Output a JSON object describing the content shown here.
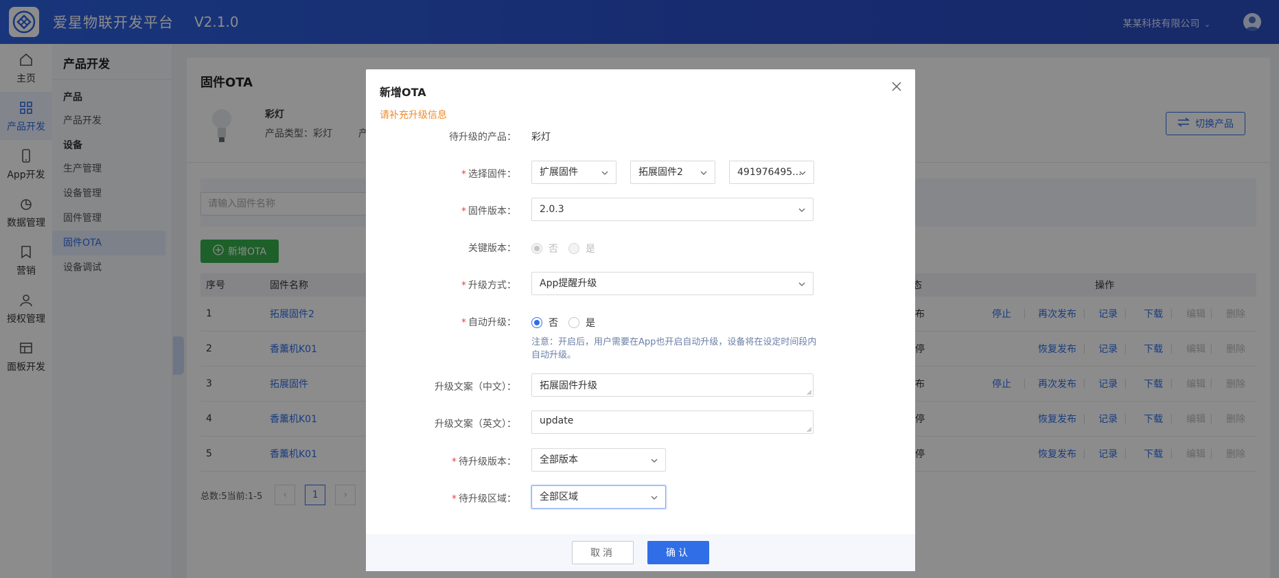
{
  "header": {
    "title": "爱星物联开发平台",
    "version": "V2.1.0",
    "company": "某某科技有限公司"
  },
  "rail": [
    {
      "label": "主页",
      "icon": "home-icon"
    },
    {
      "label": "产品开发",
      "icon": "grid-icon"
    },
    {
      "label": "App开发",
      "icon": "phone-icon"
    },
    {
      "label": "数据管理",
      "icon": "pie-chart-icon"
    },
    {
      "label": "营销",
      "icon": "bookmark-icon"
    },
    {
      "label": "授权管理",
      "icon": "user-icon"
    },
    {
      "label": "面板开发",
      "icon": "panel-icon"
    }
  ],
  "subnav": {
    "title": "产品开发",
    "group_product": "产品",
    "link_product_dev": "产品开发",
    "group_device": "设备",
    "link_production": "生产管理",
    "link_device_mgmt": "设备管理",
    "link_firmware_mgmt": "固件管理",
    "link_firmware_ota": "固件OTA",
    "link_device_debug": "设备调试"
  },
  "page": {
    "title": "固件OTA",
    "product_name": "彩灯",
    "product_type": "产品类型：彩灯",
    "product_extra": "产品",
    "switch_label": "切换产品",
    "search_placeholder": "请输入固件名称",
    "add_label": "新增OTA"
  },
  "table": {
    "headers": {
      "index": "序号",
      "name": "固件名称",
      "status": "态",
      "actions": "操作"
    },
    "rows": [
      {
        "index": "1",
        "name": "拓展固件2",
        "status": "布",
        "stop": "停止",
        "pub": "再次发布",
        "record": "记录",
        "download": "下载",
        "edit": "编辑",
        "del": "删除"
      },
      {
        "index": "2",
        "name": "香薰机K01",
        "status": "停",
        "stop": "",
        "pub": "恢复发布",
        "record": "记录",
        "download": "下载",
        "edit": "编辑",
        "del": "删除"
      },
      {
        "index": "3",
        "name": "拓展固件",
        "status": "布",
        "stop": "停止",
        "pub": "再次发布",
        "record": "记录",
        "download": "下载",
        "edit": "编辑",
        "del": "删除"
      },
      {
        "index": "4",
        "name": "香薰机K01",
        "status": "停",
        "stop": "",
        "pub": "恢复发布",
        "record": "记录",
        "download": "下载",
        "edit": "编辑",
        "del": "删除"
      },
      {
        "index": "5",
        "name": "香薰机K01",
        "status": "停",
        "stop": "",
        "pub": "恢复发布",
        "record": "记录",
        "download": "下载",
        "edit": "编辑",
        "del": "删除"
      }
    ]
  },
  "pager": {
    "total": "总数:5当前:1-5",
    "current": "1"
  },
  "modal": {
    "title": "新增OTA",
    "subtitle": "请补充升级信息",
    "product_label": "待升级的产品：",
    "product_value": "彩灯",
    "firmware_label": "选择固件：",
    "firmware_type": "扩展固件",
    "firmware_name": "拓展固件2",
    "firmware_id": "491976495...",
    "version_label": "固件版本：",
    "version_value": "2.0.3",
    "key_label": "关键版本：",
    "key_no": "否",
    "key_yes": "是",
    "method_label": "升级方式：",
    "method_value": "App提醒升级",
    "auto_label": "自动升级：",
    "auto_no": "否",
    "auto_yes": "是",
    "auto_note": "注意：开启后，用户需要在App也开启自动升级，设备将在设定时间段内自动升级。",
    "copy_cn_label": "升级文案（中文）：",
    "copy_cn_value": "拓展固件升级",
    "copy_en_label": "升级文案（英文）：",
    "copy_en_value": "update",
    "target_version_label": "待升级版本：",
    "target_version_value": "全部版本",
    "target_region_label": "待升级区域：",
    "target_region_value": "全部区域",
    "cancel": "取消",
    "confirm": "确认"
  },
  "colors": {
    "primary": "#2f6ee6",
    "success": "#36b04b",
    "warning": "#f08b2a",
    "danger": "#f03e3e"
  }
}
